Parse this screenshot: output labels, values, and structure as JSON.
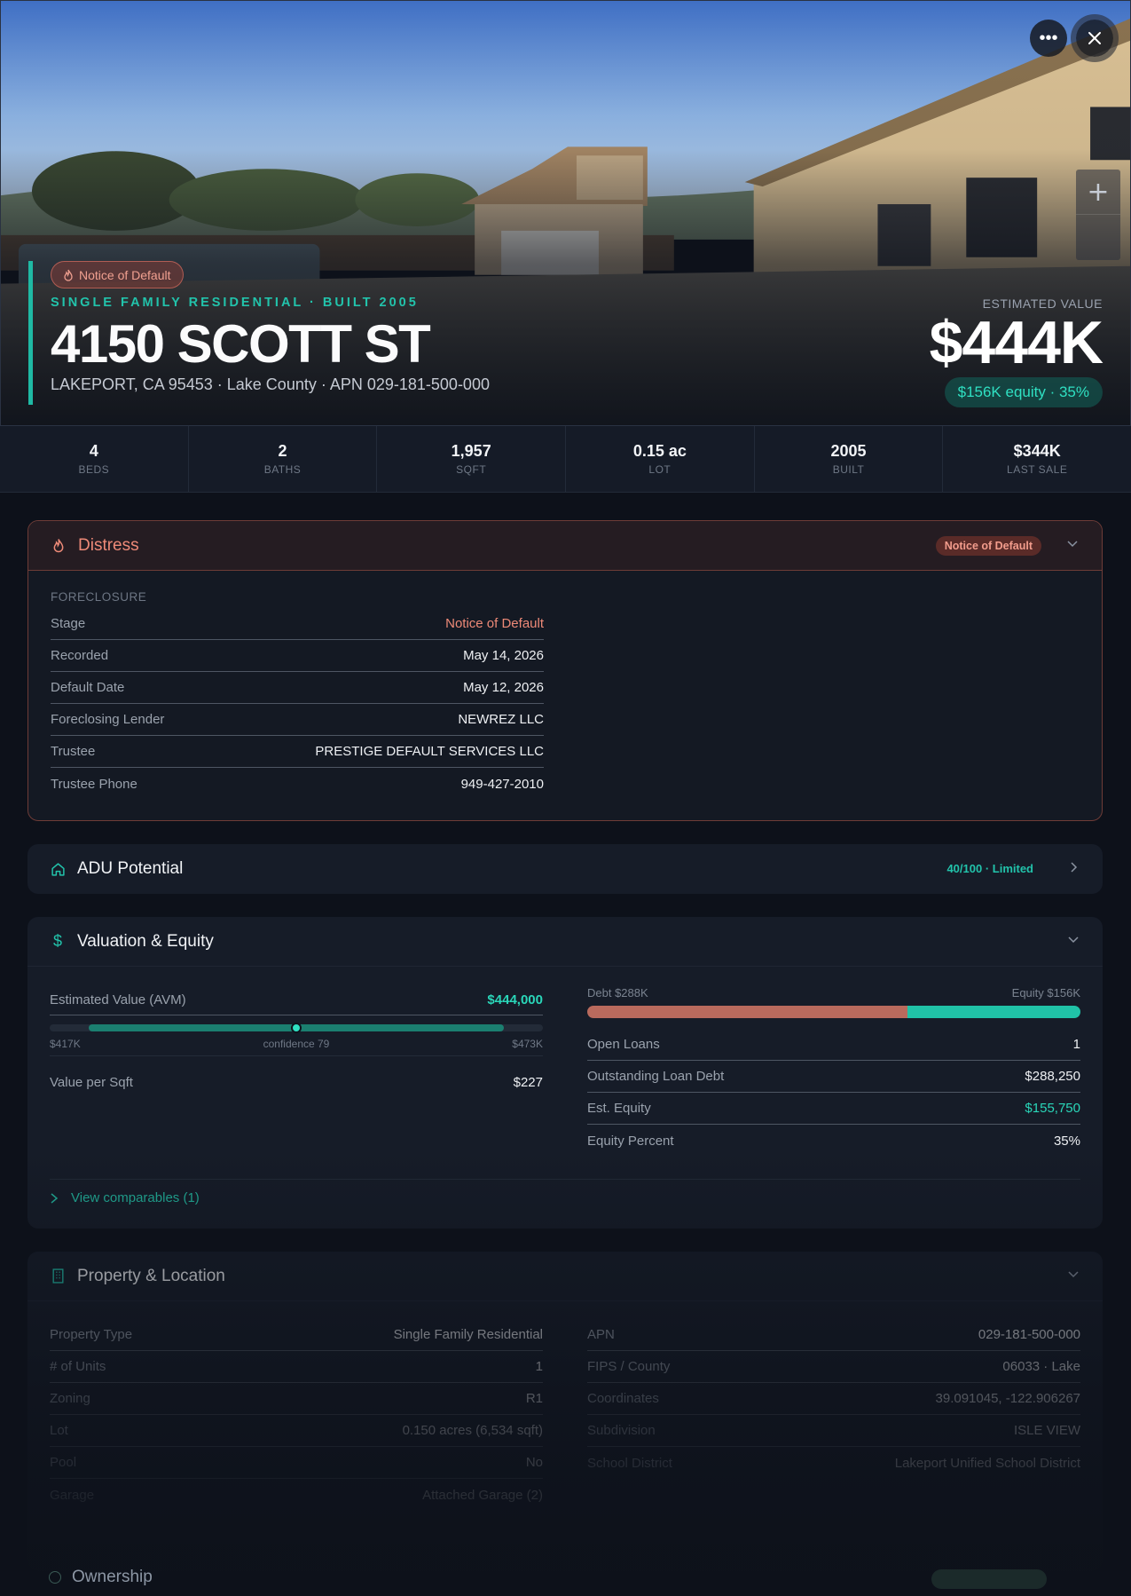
{
  "hero": {
    "alert_badge": "Notice of Default",
    "eyebrow": "SINGLE FAMILY RESIDENTIAL · BUILT 2005",
    "address": "4150 SCOTT ST",
    "subline": "LAKEPORT, CA 95453 · Lake County · APN 029-181-500-000",
    "estimated_value_label": "ESTIMATED VALUE",
    "estimated_value": "$444K",
    "equity_pill": "$156K equity · 35%",
    "more_icon": "ellipsis-icon",
    "close_icon": "close-icon",
    "zoom_in": "+",
    "zoom_out": ""
  },
  "stats": [
    {
      "value": "4",
      "label": "BEDS"
    },
    {
      "value": "2",
      "label": "BATHS"
    },
    {
      "value": "1,957",
      "label": "SQFT"
    },
    {
      "value": "0.15 ac",
      "label": "LOT"
    },
    {
      "value": "2005",
      "label": "BUILT"
    },
    {
      "value": "$344K",
      "label": "LAST SALE"
    }
  ],
  "distress": {
    "title": "Distress",
    "badge": "Notice of Default",
    "section_label": "FORECLOSURE",
    "rows": [
      {
        "key": "Stage",
        "value": "Notice of Default"
      },
      {
        "key": "Recorded",
        "value": "May 14, 2026"
      },
      {
        "key": "Default Date",
        "value": "May 12, 2026"
      },
      {
        "key": "Foreclosing Lender",
        "value": "NEWREZ LLC"
      },
      {
        "key": "Trustee",
        "value": "PRESTIGE DEFAULT SERVICES LLC"
      },
      {
        "key": "Trustee Phone",
        "value": "949-427-2010"
      }
    ]
  },
  "adu": {
    "title": "ADU Potential",
    "score": "40/100 · Limited"
  },
  "valuation": {
    "title": "Valuation & Equity",
    "avm_label": "Estimated Value (AVM)",
    "avm_value": "$444,000",
    "range_low": "$417K",
    "range_high": "$473K",
    "confidence_label": "confidence 79",
    "confidence_position": 0.5,
    "value_per_sqft_label": "Value per Sqft",
    "value_per_sqft": "$227",
    "debt_label": "Debt $288K",
    "equity_label": "Equity $156K",
    "debt_fraction": 0.65,
    "rows": [
      {
        "key": "Open Loans",
        "value": "1"
      },
      {
        "key": "Outstanding Loan Debt",
        "value": "$288,250"
      },
      {
        "key": "Est. Equity",
        "value": "$155,750"
      },
      {
        "key": "Equity Percent",
        "value": "35%"
      }
    ],
    "comparables_link": "View comparables (1)"
  },
  "property": {
    "title": "Property & Location",
    "left_rows": [
      {
        "key": "Property Type",
        "value": "Single Family Residential"
      },
      {
        "key": "# of Units",
        "value": "1"
      },
      {
        "key": "Zoning",
        "value": "R1"
      },
      {
        "key": "Lot",
        "value": "0.150 acres (6,534 sqft)"
      },
      {
        "key": "Pool",
        "value": "No"
      },
      {
        "key": "Garage",
        "value": "Attached Garage (2)"
      }
    ],
    "right_rows": [
      {
        "key": "APN",
        "value": "029-181-500-000"
      },
      {
        "key": "FIPS / County",
        "value": "06033 · Lake"
      },
      {
        "key": "Coordinates",
        "value": "39.091045, -122.906267"
      },
      {
        "key": "Subdivision",
        "value": "ISLE VIEW"
      },
      {
        "key": "School District",
        "value": "Lakeport Unified School District"
      }
    ]
  },
  "ownership": {
    "title": "Ownership"
  },
  "colors": {
    "accent_teal": "#1fb9a4",
    "distress_red": "#ee8a78",
    "background": "#0d111a",
    "card": "#161c28"
  }
}
